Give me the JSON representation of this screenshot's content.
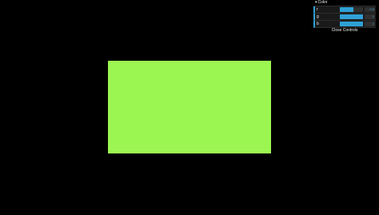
{
  "canvas": {
    "background": "#000000",
    "rect_color": "#9cf651"
  },
  "gui": {
    "folder_title": "Color",
    "folder_arrow": "▾",
    "controls": [
      {
        "label": "r",
        "value": "0.6",
        "fraction": 0.6
      },
      {
        "label": "g",
        "value": "1",
        "fraction": 1.0
      },
      {
        "label": "b",
        "value": "1",
        "fraction": 1.0
      }
    ],
    "close_label": "Close Controls",
    "accent": "#2fa1d6"
  }
}
